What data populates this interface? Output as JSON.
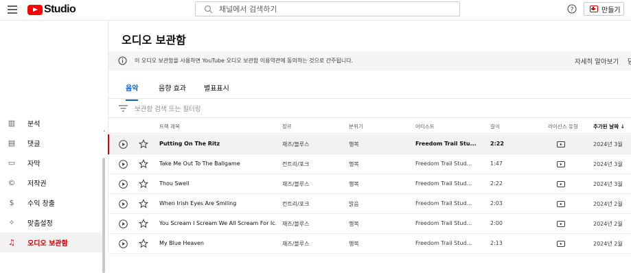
{
  "header": {
    "logo_text": "Studio",
    "search_placeholder": "채널에서 검색하기",
    "create_label": "만들기"
  },
  "sidebar": {
    "items": [
      {
        "label": "분석",
        "icon": "analytics-icon",
        "glyph": "▥"
      },
      {
        "label": "댓글",
        "icon": "comments-icon",
        "glyph": "▤"
      },
      {
        "label": "자막",
        "icon": "subtitles-icon",
        "glyph": "▭"
      },
      {
        "label": "저작권",
        "icon": "copyright-icon",
        "glyph": "©"
      },
      {
        "label": "수익 창출",
        "icon": "monetization-icon",
        "glyph": "$"
      },
      {
        "label": "맞춤설정",
        "icon": "customization-icon",
        "glyph": "✧"
      },
      {
        "label": "오디오 보관함",
        "icon": "audio-library-icon",
        "glyph": "♫",
        "active": true
      }
    ]
  },
  "main": {
    "title": "오디오 보관함",
    "notice": {
      "text": "이 오디오 보관함을 사용하면 YouTube 오디오 보관함 이용약관에 동의하는 것으로 간주됩니다.",
      "link": "자세히 알아보기",
      "link2": "닫"
    },
    "tabs": [
      {
        "label": "음악",
        "active": true
      },
      {
        "label": "음향 효과"
      },
      {
        "label": "별표표시"
      }
    ],
    "filter_placeholder": "보관함 검색 또는 필터링",
    "columns": {
      "title": "트랙 제목",
      "genre": "장르",
      "mood": "분위기",
      "artist": "아티스트",
      "length": "길이",
      "license": "라이선스 유형",
      "added": "추가된 날짜"
    },
    "rows": [
      {
        "title": "Putting On The Ritz",
        "genre": "재즈/블루스",
        "mood": "행복",
        "artist": "Freedom Trail Stu...",
        "length": "2:22",
        "added": "2024년 3월"
      },
      {
        "title": "Take Me Out To The Ballgame",
        "genre": "컨트리/포크",
        "mood": "행복",
        "artist": "Freedom Trail Stud...",
        "length": "1:47",
        "added": "2024년 3월"
      },
      {
        "title": "Thou Swell",
        "genre": "재즈/블루스",
        "mood": "행복",
        "artist": "Freedom Trail Stud...",
        "length": "2:22",
        "added": "2024년 3월"
      },
      {
        "title": "When Irish Eyes Are Smiling",
        "genre": "컨트리/포크",
        "mood": "밝음",
        "artist": "Freedom Trail Stud...",
        "length": "2:03",
        "added": "2024년 2월"
      },
      {
        "title": "You Scream I Scream We All Scream For Ic...",
        "genre": "재즈/블루스",
        "mood": "행복",
        "artist": "Freedom Trail Stud...",
        "length": "2:00",
        "added": "2024년 2월"
      },
      {
        "title": "My Blue Heaven",
        "genre": "재즈/블루스",
        "mood": "행복",
        "artist": "Freedom Trail Stud...",
        "length": "2:13",
        "added": "2024년 2월"
      }
    ]
  },
  "colors": {
    "accent": "#cc0000",
    "tab_active": "#065fd4",
    "brand_red": "#ff0000"
  }
}
